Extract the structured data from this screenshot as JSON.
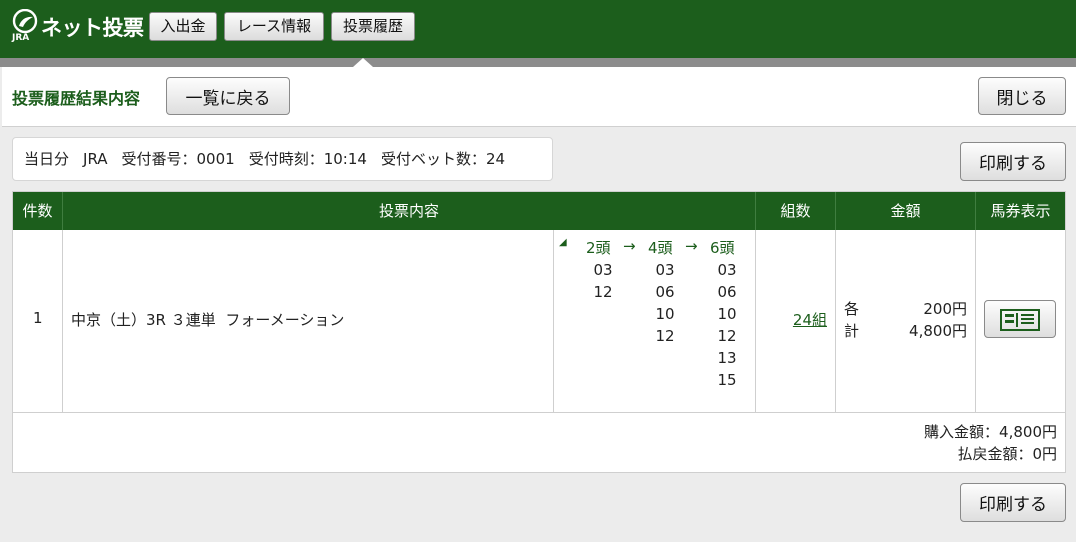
{
  "header": {
    "brand": "ネット投票",
    "logo_text": "JRA",
    "nav": [
      {
        "label": "入出金"
      },
      {
        "label": "レース情報"
      },
      {
        "label": "投票履歴"
      }
    ],
    "colors": {
      "brand_green": "#1c5e1c",
      "strip_gray": "#8c8c8c"
    }
  },
  "panel": {
    "title": "投票履歴結果内容",
    "back_button": "一覧に戻る",
    "close_button": "閉じる",
    "print_button": "印刷する"
  },
  "info": {
    "day": "当日分",
    "org": "JRA",
    "receipt_no": "受付番号：0001",
    "receipt_time": "受付時刻：10:14",
    "bet_count": "受付ベット数：24"
  },
  "table": {
    "headers": [
      "件数",
      "投票内容",
      "組数",
      "金額",
      "馬券表示"
    ],
    "rows": [
      {
        "no": "1",
        "race": "中京（土）3R",
        "bet_type": "３連単",
        "method": "フォーメーション",
        "formation": {
          "marker": "◢",
          "heads": [
            "2頭",
            "4頭",
            "6頭"
          ],
          "arrow": "→",
          "columns": [
            [
              "03",
              "12"
            ],
            [
              "03",
              "06",
              "10",
              "12"
            ],
            [
              "03",
              "06",
              "10",
              "12",
              "13",
              "15"
            ]
          ]
        },
        "combos": "24組",
        "amount": {
          "each_label": "各",
          "each_value": "200円",
          "total_label": "計",
          "total_value": "4,800円"
        },
        "ticket_icon": "ticket-icon"
      }
    ],
    "purchase_total": "購入金額：4,800円",
    "refund_total": "払戻金額：0円"
  }
}
